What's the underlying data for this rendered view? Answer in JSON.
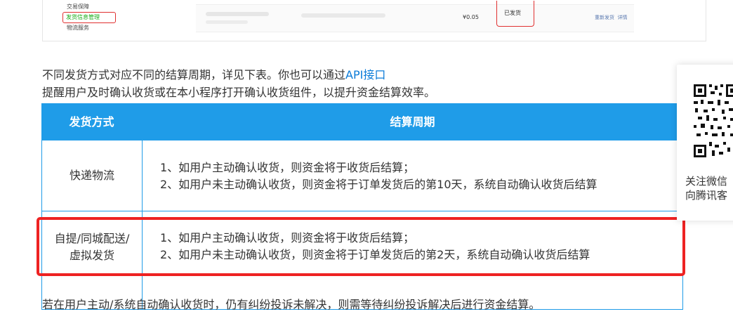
{
  "screenshot": {
    "sidebar_items": [
      "交易保障",
      "发货信息管理",
      "物流服务"
    ],
    "row_price": "¥0.05",
    "row_status": "已发货",
    "row_actions": [
      "重新发货",
      "详情"
    ]
  },
  "intro": {
    "line1_text": "不同发货方式对应不同的结算周期，详见下表。你也可以通过",
    "line1_link": "API接口",
    "line2": "提醒用户及时确认收货或在本小程序打开确认收货组件，以提升资金结算效率。"
  },
  "table": {
    "headers": [
      "发货方式",
      "结算周期"
    ],
    "rows": [
      {
        "method": [
          "快递物流"
        ],
        "lines": [
          "1、如用户主动确认收货，则资金将于收货后结算；",
          "2、如用户未主动确认收货，则资金将于订单发货后的第10天，系统自动确认收货后结算"
        ]
      },
      {
        "method": [
          "自提/同城配送/",
          "虚拟发货"
        ],
        "lines": [
          "1、如用户主动确认收货，则资金将于收货后结算；",
          "2、如用户未主动确认收货，则资金将于订单发货后的第2天，系统自动确认收货后结算"
        ]
      }
    ]
  },
  "footer_note": "若在用户主动/系统自动确认收货时，仍有纠纷投诉未解决，则需等待纠纷投诉解决后进行资金结算。",
  "float_card": {
    "icon": "qr-code-icon",
    "lines": [
      "关注微信",
      "向腾讯客"
    ]
  },
  "colors": {
    "table_header": "#1f9ce8",
    "highlight_border": "#ee2222",
    "link": "#0a7bd8"
  }
}
